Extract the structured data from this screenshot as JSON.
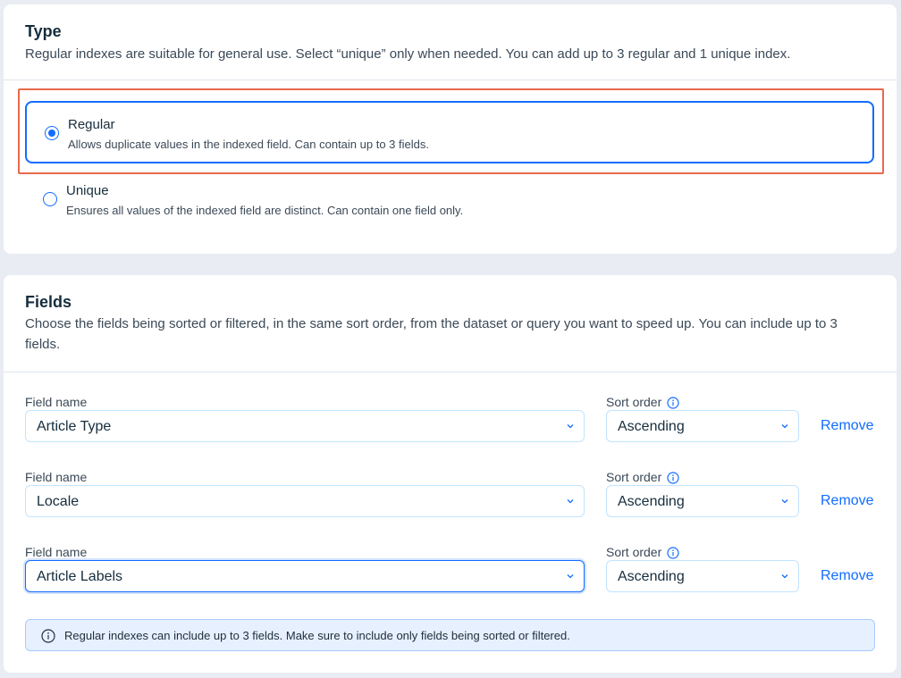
{
  "type_section": {
    "title": "Type",
    "subtitle": "Regular indexes are suitable for general use. Select “unique” only when needed. You can add up to 3 regular and 1 unique index.",
    "options": [
      {
        "title": "Regular",
        "description": "Allows duplicate values in the indexed field. Can contain up to 3 fields.",
        "selected": true
      },
      {
        "title": "Unique",
        "description": "Ensures all values of the indexed field are distinct. Can contain one field only.",
        "selected": false
      }
    ]
  },
  "fields_section": {
    "title": "Fields",
    "subtitle": "Choose the fields being sorted or filtered, in the same sort order, from the dataset or query you want to speed up. You can include up to 3 fields.",
    "field_label": "Field name",
    "sort_label": "Sort order",
    "remove_label": "Remove",
    "rows": [
      {
        "field": "Article Type",
        "sort": "Ascending"
      },
      {
        "field": "Locale",
        "sort": "Ascending"
      },
      {
        "field": "Article Labels",
        "sort": "Ascending"
      }
    ],
    "notice": "Regular indexes can include up to 3 fields. Make sure to include only fields being sorted or filtered."
  },
  "colors": {
    "accent": "#116dff",
    "highlight": "#e8694f",
    "notice_bg": "#e7f0ff"
  }
}
